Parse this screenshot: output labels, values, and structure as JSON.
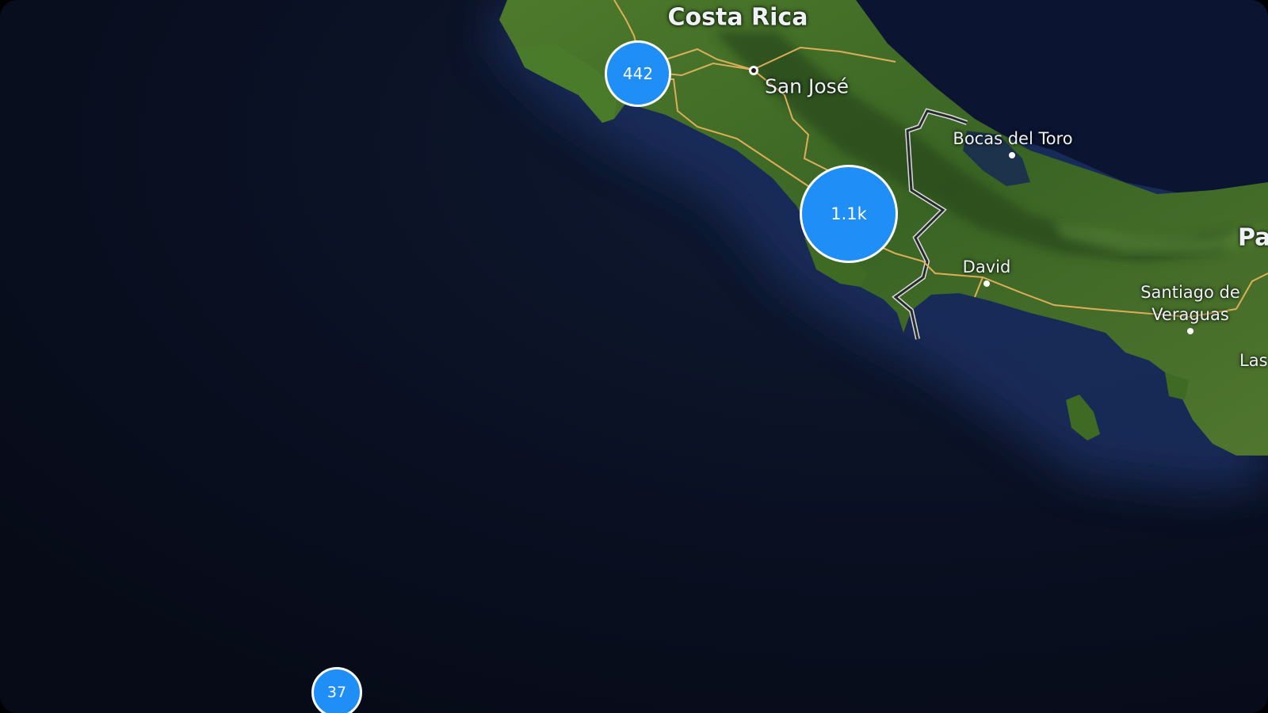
{
  "map": {
    "style": "satellite-dark",
    "colors": {
      "ocean": "#0a1022",
      "land": "#3f6a25",
      "road": "#e6b25c",
      "border": "#2a2a2a",
      "cluster_fill": "#1f8ef7",
      "cluster_stroke": "#ffffff"
    },
    "labels": {
      "country_costa_rica": "Costa Rica",
      "city_san_jose": "San José",
      "city_bocas_del_toro": "Bocas del Toro",
      "city_david": "David",
      "city_santiago_line1": "Santiago de",
      "city_santiago_line2": "Veraguas",
      "country_panama_partial": "Pa",
      "city_las_partial": "Las"
    },
    "clusters": {
      "guanacaste": "442",
      "osa": "1.1k",
      "cocos": "37"
    }
  }
}
